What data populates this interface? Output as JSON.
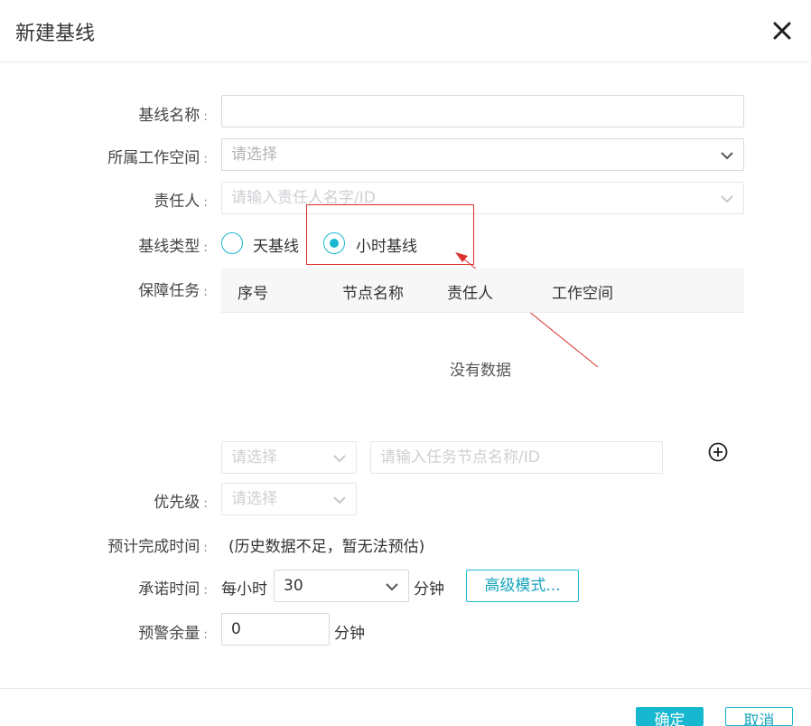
{
  "dialog": {
    "title": "新建基线"
  },
  "form": {
    "name": {
      "label": "基线名称",
      "colon": ":",
      "value": ""
    },
    "workspace": {
      "label": "所属工作空间",
      "colon": ":",
      "placeholder": "请选择"
    },
    "owner": {
      "label": "责任人",
      "colon": ":",
      "placeholder": "请输入责任人名字/ID"
    },
    "baseline_type": {
      "label": "基线类型",
      "colon": ":",
      "options": [
        {
          "label": "天基线",
          "checked": false
        },
        {
          "label": "小时基线",
          "checked": true
        }
      ]
    },
    "tasks": {
      "label": "保障任务",
      "colon": ":",
      "columns": [
        "序号",
        "节点名称",
        "责任人",
        "工作空间"
      ],
      "empty_text": "没有数据",
      "workspace_select_placeholder": "请选择",
      "node_input_placeholder": "请输入任务节点名称/ID"
    },
    "priority": {
      "label": "优先级",
      "colon": ":",
      "placeholder": "请选择"
    },
    "estimated_time": {
      "label": "预计完成时间",
      "colon": ":",
      "value": "(历史数据不足，暂无法预估)"
    },
    "commit_time": {
      "label": "承诺时间",
      "colon": ":",
      "prefix": "每小时",
      "value": "30",
      "unit": "分钟",
      "advanced_button": "高级模式..."
    },
    "warning_margin": {
      "label": "预警余量",
      "colon": ":",
      "value": "0",
      "unit": "分钟"
    }
  },
  "footer": {
    "ok_label": "确定",
    "cancel_label": "取消"
  },
  "colors": {
    "accent": "#17b8cf",
    "annotation": "#d9302c"
  },
  "icons": [
    "close-icon",
    "chevron-down-icon",
    "add-circle-icon"
  ]
}
